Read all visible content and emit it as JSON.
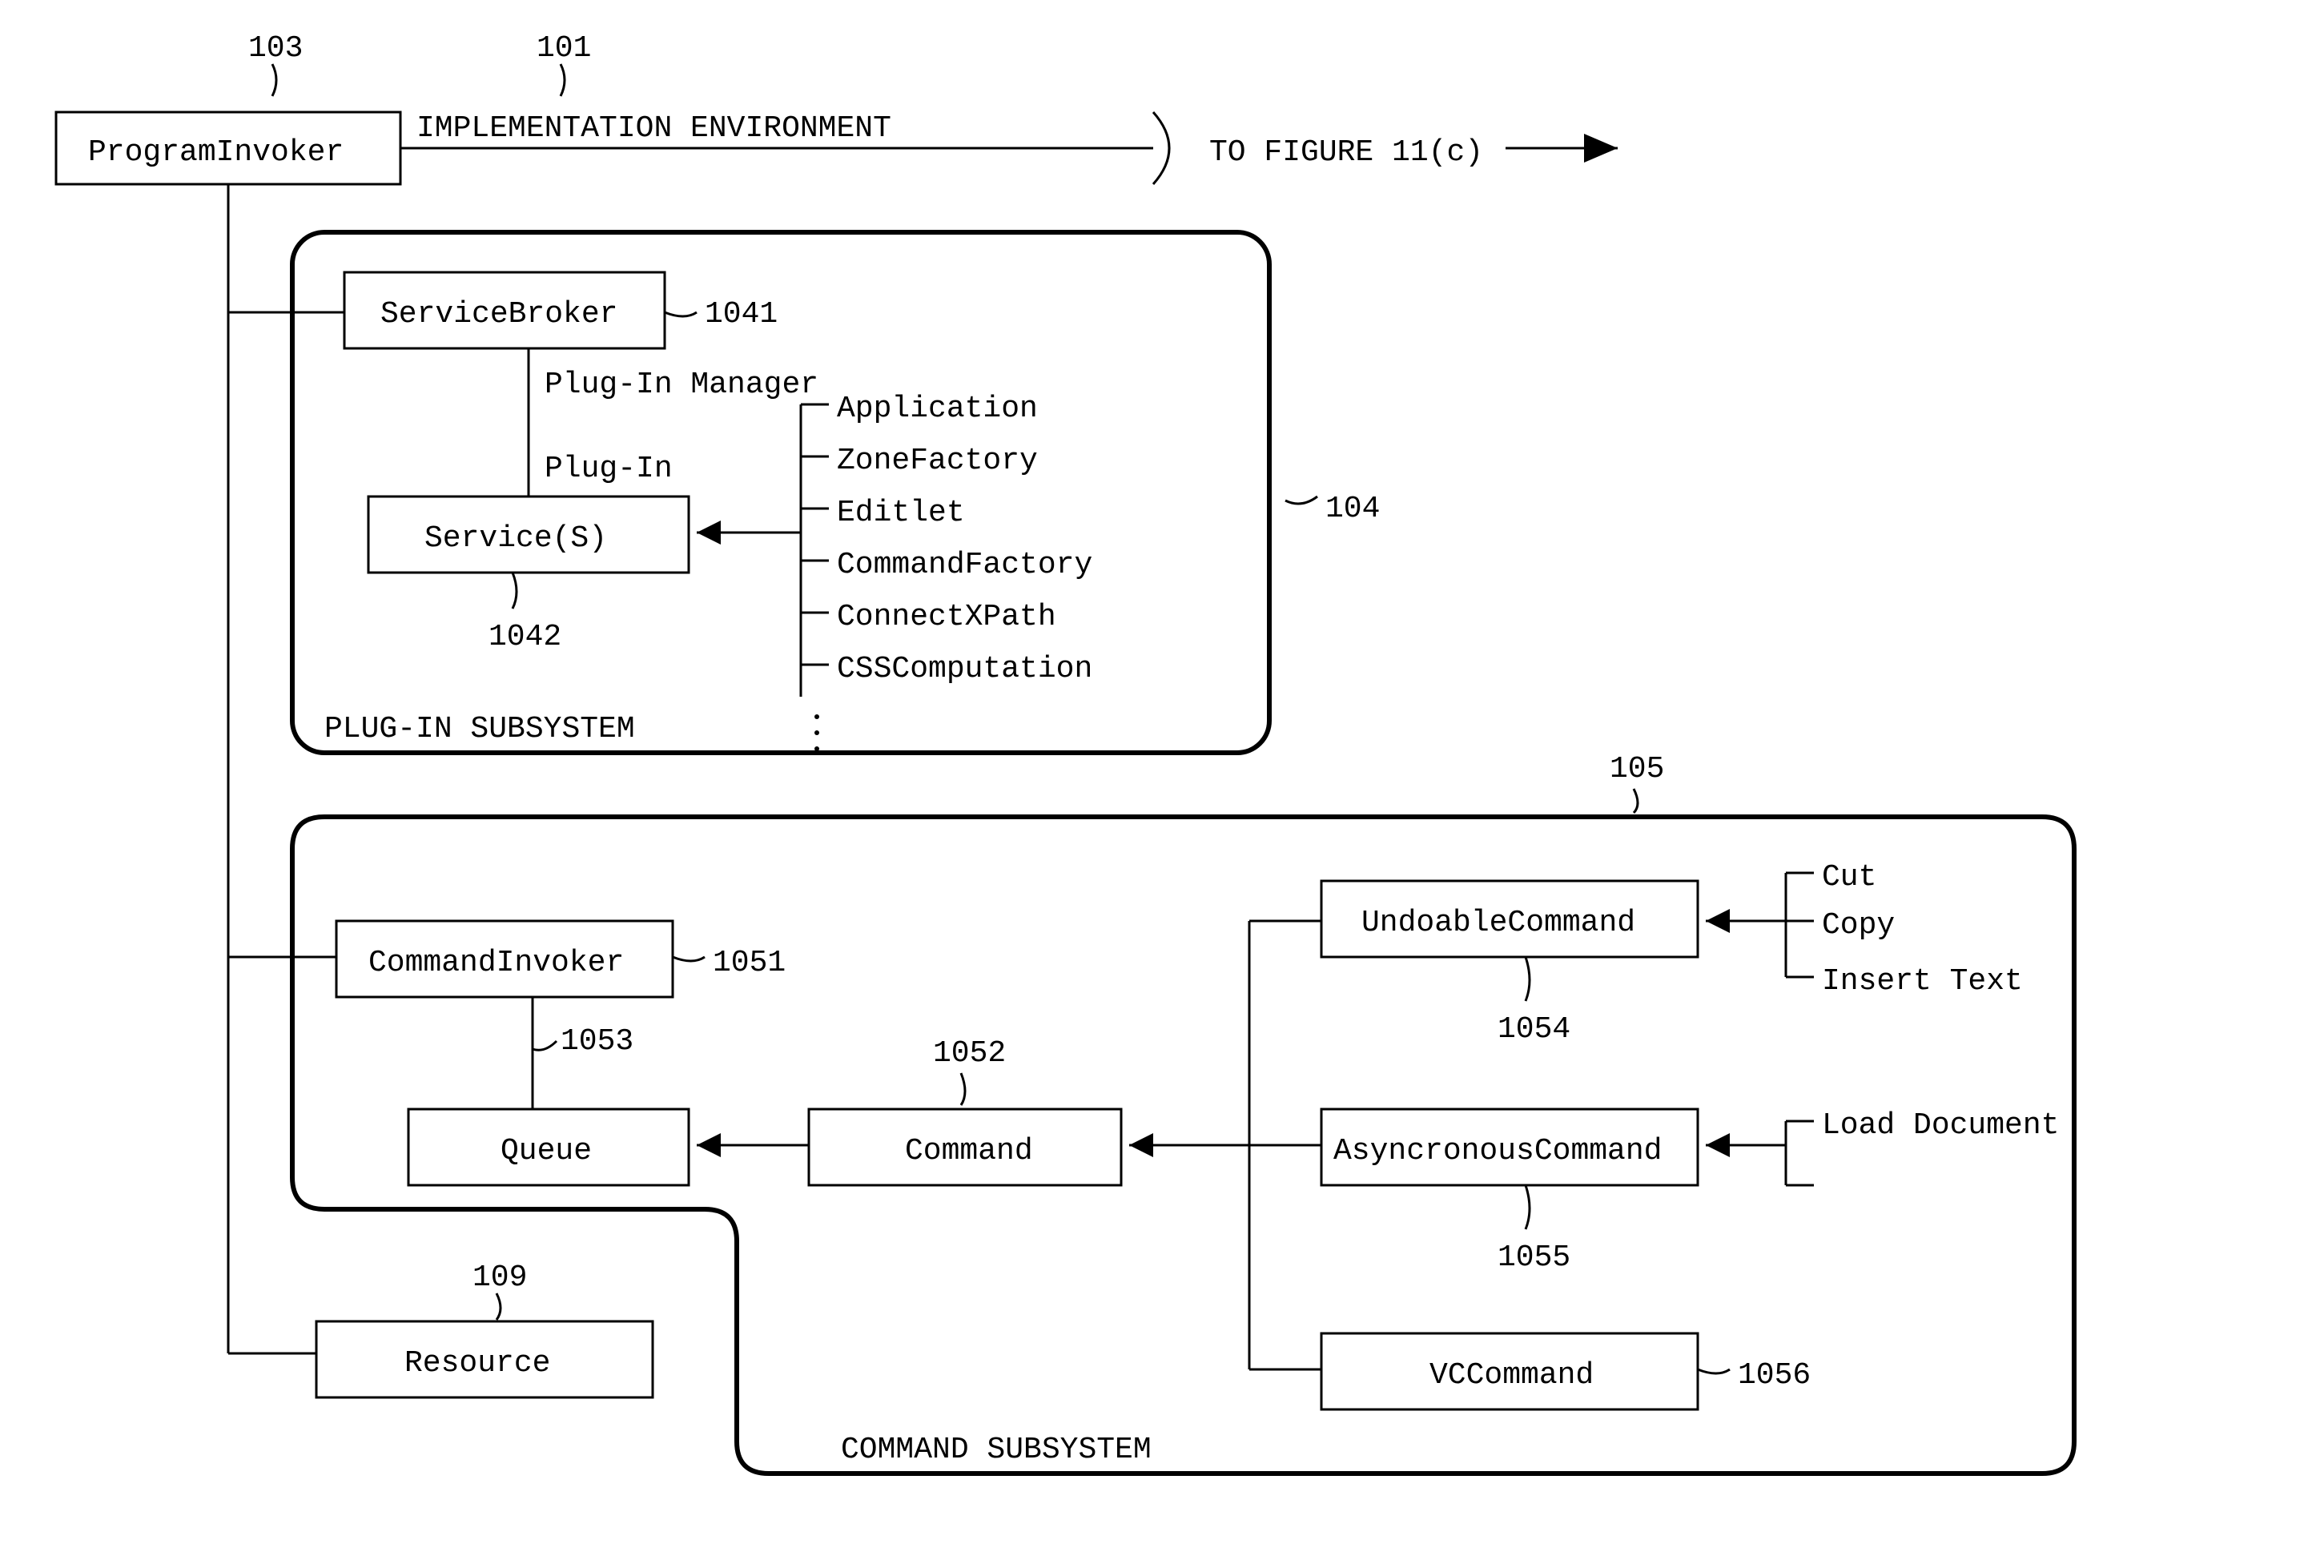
{
  "refs": {
    "r101": "101",
    "r103": "103",
    "r104": "104",
    "r105": "105",
    "r109": "109",
    "r1041": "1041",
    "r1042": "1042",
    "r1051": "1051",
    "r1052": "1052",
    "r1053": "1053",
    "r1054": "1054",
    "r1055": "1055",
    "r1056": "1056"
  },
  "labels": {
    "programInvoker": "ProgramInvoker",
    "implEnv": "IMPLEMENTATION ENVIRONMENT",
    "toFig": "TO FIGURE 11(c)",
    "serviceBroker": "ServiceBroker",
    "pluginManager": "Plug-In Manager",
    "plugin": "Plug-In",
    "service": "Service(S)",
    "application": "Application",
    "zoneFactory": "ZoneFactory",
    "editlet": "Editlet",
    "commandFactory": "CommandFactory",
    "connectXPath": "ConnectXPath",
    "cssComputation": "CSSComputation",
    "pluginSubsystem": "PLUG-IN SUBSYSTEM",
    "commandInvoker": "CommandInvoker",
    "queue": "Queue",
    "command": "Command",
    "undoableCommand": "UndoableCommand",
    "asyncCommand": "AsyncronousCommand",
    "vcCommand": "VCCommand",
    "cut": "Cut",
    "copy": "Copy",
    "insertText": "Insert Text",
    "loadDocument": "Load Document",
    "resource": "Resource",
    "commandSubsystem": "COMMAND SUBSYSTEM"
  }
}
